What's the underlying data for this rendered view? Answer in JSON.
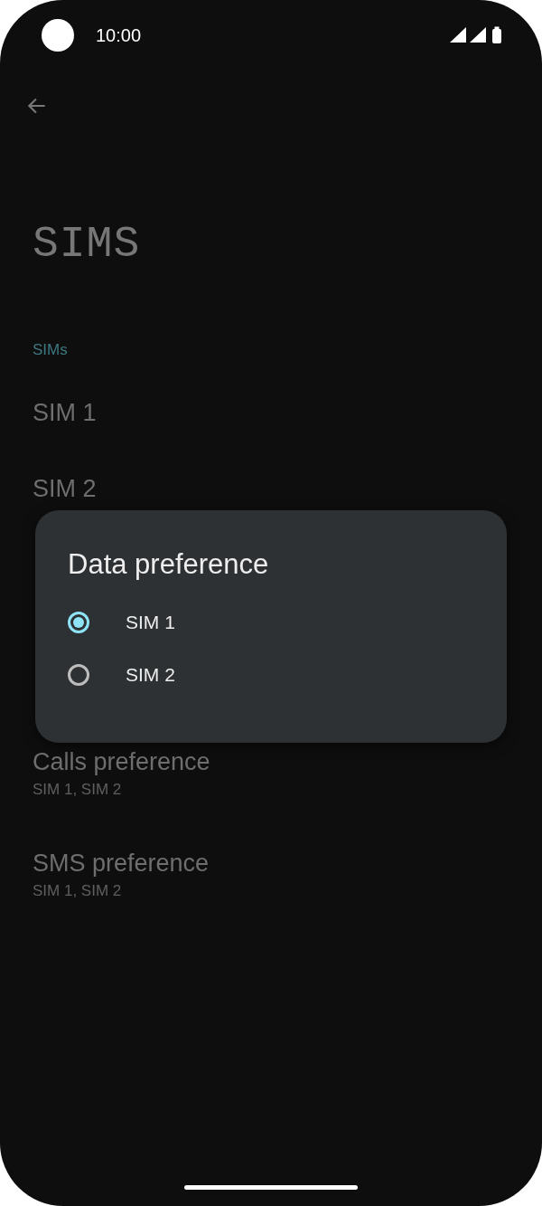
{
  "status_bar": {
    "time": "10:00"
  },
  "page": {
    "title": "SIMS"
  },
  "sections": [
    {
      "header": "SIMs",
      "items": [
        {
          "title": "SIM 1"
        },
        {
          "title": "SIM 2"
        }
      ]
    }
  ],
  "preferences": [
    {
      "title": "Calls preference",
      "summary": "SIM 1, SIM 2"
    },
    {
      "title": "SMS preference",
      "summary": "SIM 1, SIM 2"
    }
  ],
  "dialog": {
    "title": "Data preference",
    "options": [
      {
        "label": "SIM 1",
        "selected": true
      },
      {
        "label": "SIM 2",
        "selected": false
      }
    ]
  }
}
